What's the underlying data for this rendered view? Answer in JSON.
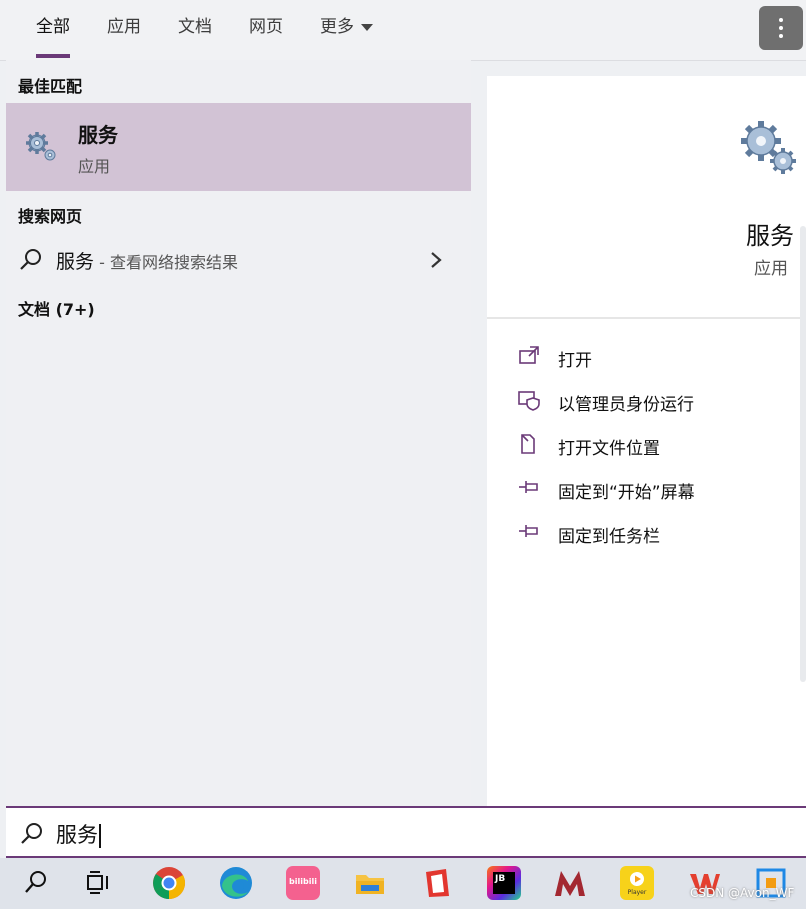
{
  "tabs": [
    {
      "label": "全部",
      "active": true
    },
    {
      "label": "应用"
    },
    {
      "label": "文档"
    },
    {
      "label": "网页"
    },
    {
      "label": "更多"
    }
  ],
  "sections": {
    "best_match": "最佳匹配",
    "web_search": "搜索网页",
    "documents": "文档 (7+)"
  },
  "best_result": {
    "title": "服务",
    "subtitle": "应用",
    "icon": "gears-icon"
  },
  "web_result": {
    "query": "服务",
    "suffix": " - 查看网络搜索结果"
  },
  "preview": {
    "title": "服务",
    "type": "应用",
    "actions": [
      {
        "label": "打开",
        "icon": "open-icon"
      },
      {
        "label": "以管理员身份运行",
        "icon": "admin-shield-icon"
      },
      {
        "label": "打开文件位置",
        "icon": "file-location-icon"
      },
      {
        "label": "固定到“开始”屏幕",
        "icon": "pin-icon"
      },
      {
        "label": "固定到任务栏",
        "icon": "pin-icon"
      }
    ]
  },
  "search": {
    "value": "服务"
  },
  "taskbar": {
    "items": [
      "search-icon",
      "task-view-icon",
      "chrome-icon",
      "edge-icon",
      "bilibili-icon",
      "file-explorer-icon",
      "red-app-icon",
      "jetbrains-icon",
      "mendeley-icon",
      "potplayer-icon",
      "wps-icon",
      "app-icon"
    ],
    "bilibili_text": "bilibili",
    "potplayer_text": "Player",
    "jetbrains_text": "JB"
  },
  "watermark": "CSDN @Avon_WF",
  "colors": {
    "accent": "#6b3a78",
    "selection": "#d2c3d5",
    "panel": "#ffffff",
    "background": "#eff0f3"
  }
}
